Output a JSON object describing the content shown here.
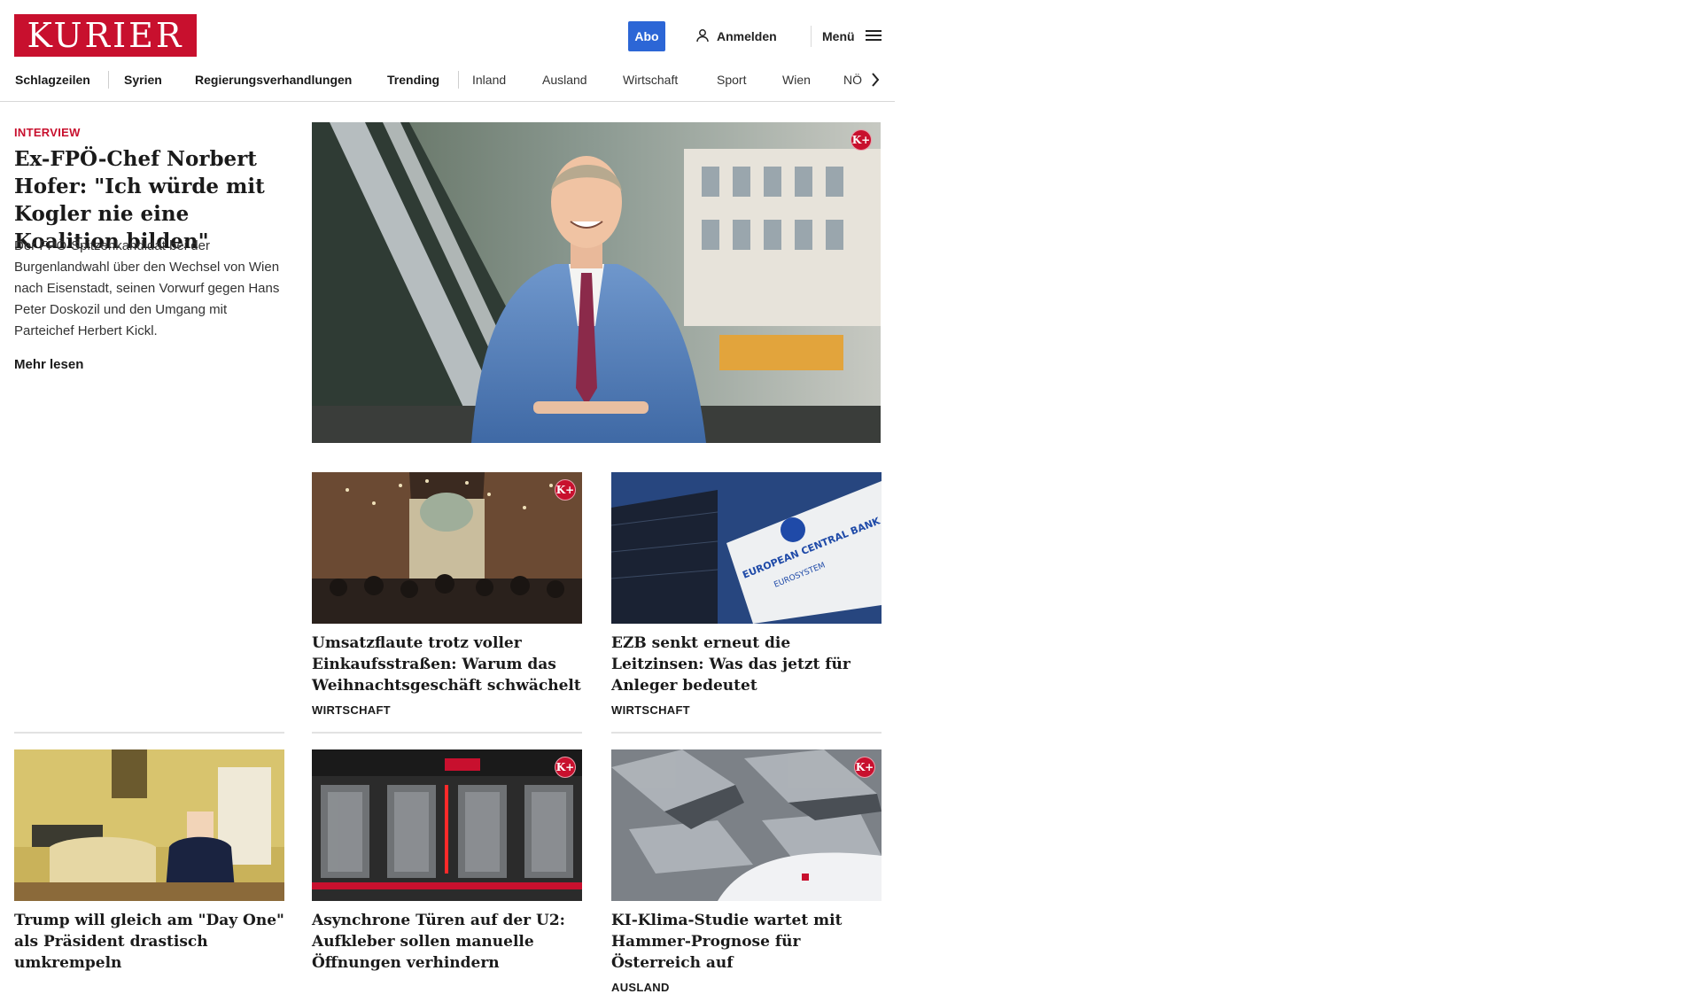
{
  "header": {
    "logo_text": "KURIER",
    "abo_label": "Abo",
    "login_label": "Anmelden",
    "menu_label": "Menü",
    "brand_color": "#c8102e",
    "abo_color": "#2c66d6"
  },
  "nav": {
    "items": [
      {
        "label": "Schlagzeilen"
      },
      {
        "label": "Syrien"
      },
      {
        "label": "Regierungsverhandlungen"
      },
      {
        "label": "Trending"
      },
      {
        "label": "Inland"
      },
      {
        "label": "Ausland"
      },
      {
        "label": "Wirtschaft"
      },
      {
        "label": "Sport"
      },
      {
        "label": "Wien"
      },
      {
        "label": "NÖ"
      }
    ]
  },
  "lead": {
    "kicker": "INTERVIEW",
    "title": "Ex-FPÖ-Chef Norbert Hofer: \"Ich würde mit Kogler nie eine Koalition bilden\"",
    "teaser": "Der FPÖ-Spitzenkandidat bei der Burgenlandwahl über den Wechsel von Wien nach Eisenstadt, seinen Vorwurf gegen Hans Peter Doskozil und den Umgang mit Parteichef Herbert Kickl.",
    "more_label": "Mehr lesen",
    "premium_badge": "K+"
  },
  "cards": [
    {
      "title": "Umsatzflaute trotz voller Einkaufsstraßen: Warum das Weihnachtsgeschäft schwächelt",
      "category": "WIRTSCHAFT",
      "premium_badge": "K+"
    },
    {
      "title": "EZB senkt erneut die Leitzinsen: Was das jetzt für Anleger bedeutet",
      "category": "WIRTSCHAFT",
      "premium_badge": ""
    },
    {
      "title": "Trump will gleich am \"Day One\" als Präsident drastisch umkrempeln",
      "category": "",
      "premium_badge": ""
    },
    {
      "title": "Asynchrone Türen auf der U2: Aufkleber sollen manuelle Öffnungen verhindern",
      "category": "",
      "premium_badge": "K+"
    },
    {
      "title": "KI-Klima-Studie wartet mit Hammer-Prognose für Österreich auf",
      "category": "AUSLAND",
      "premium_badge": "K+"
    }
  ],
  "image_text": {
    "ecb_sign_line1": "EUROPEAN CENTRAL BANK",
    "ecb_sign_line2": "EUROSYSTEM"
  }
}
